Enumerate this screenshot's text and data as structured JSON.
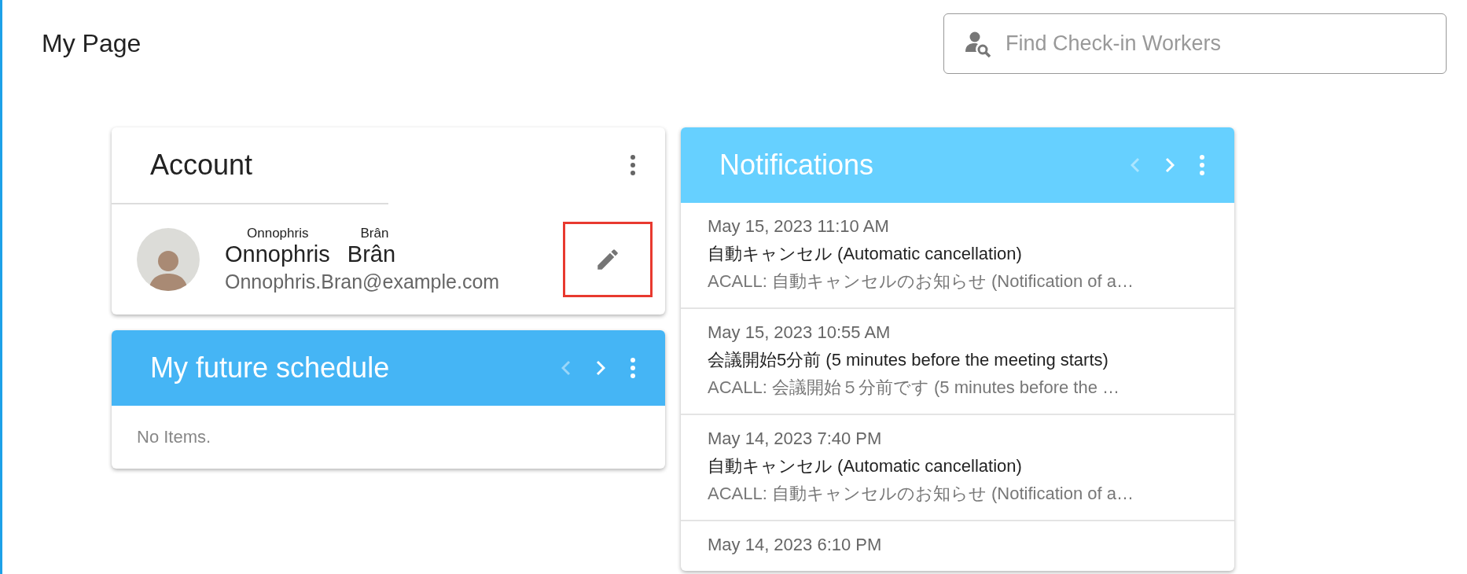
{
  "page": {
    "title": "My Page"
  },
  "search": {
    "placeholder": "Find Check-in Workers"
  },
  "account": {
    "title": "Account",
    "user": {
      "first_name_reading": "Onnophris",
      "last_name_reading": "Brân",
      "first_name": "Onnophris",
      "last_name": "Brân",
      "email": "Onnophris.Bran@example.com"
    },
    "edit_highlighted": true
  },
  "schedule": {
    "title": "My future schedule",
    "prev_disabled": true,
    "next_disabled": false,
    "empty_text": "No Items."
  },
  "notifications": {
    "title": "Notifications",
    "prev_disabled": true,
    "next_disabled": false,
    "items": [
      {
        "date": "May 15, 2023 11:10 AM",
        "title": "自動キャンセル (Automatic cancellation)",
        "summary": "ACALL: 自動キャンセルのお知らせ (Notification of a…"
      },
      {
        "date": "May 15, 2023 10:55 AM",
        "title": "会議開始5分前 (5 minutes before the meeting starts)",
        "summary": "ACALL: 会議開始５分前です (5 minutes before the …"
      },
      {
        "date": "May 14, 2023 7:40 PM",
        "title": "自動キャンセル (Automatic cancellation)",
        "summary": "ACALL: 自動キャンセルのお知らせ (Notification of a…"
      },
      {
        "date": "May 14, 2023 6:10 PM"
      }
    ]
  }
}
